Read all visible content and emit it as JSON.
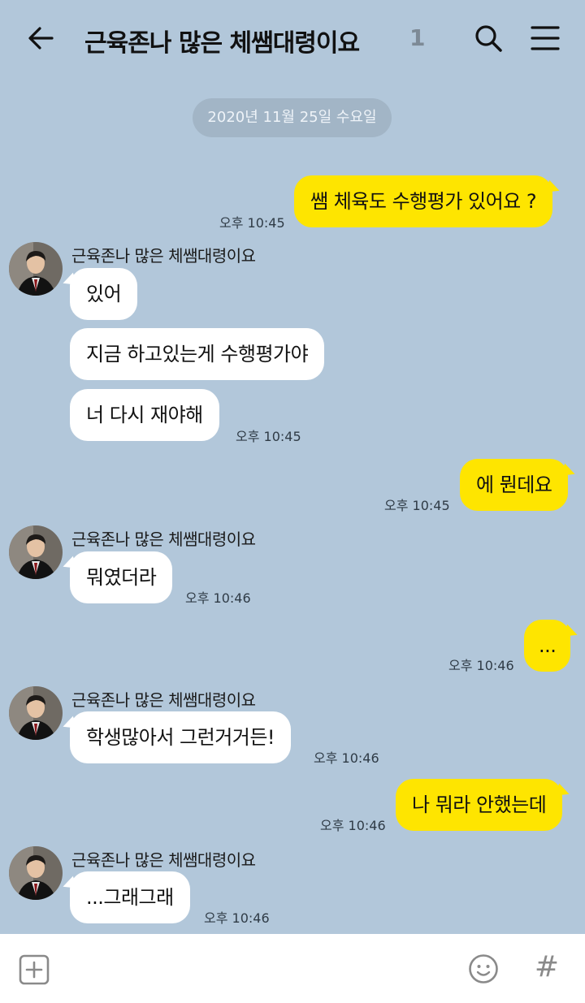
{
  "header": {
    "title": "근육존나 많은 체쌤대령이요",
    "member_count": "1"
  },
  "date_divider": "2020년 11월 25일 수요일",
  "messages": [
    {
      "text": "쌤 체육도 수행평가 있어요 ?",
      "time": "오후 10:45"
    },
    {
      "sender": "근육존나 많은 체쌤대령이요"
    },
    {
      "text": "있어"
    },
    {
      "text": "지금 하고있는게 수행평가야"
    },
    {
      "text": "너 다시 재야해",
      "time": "오후 10:45"
    },
    {
      "text": "에 뭔데요",
      "time": "오후 10:45"
    },
    {
      "sender": "근육존나 많은 체쌤대령이요"
    },
    {
      "text": "뭐였더라",
      "time": "오후 10:46"
    },
    {
      "text": "...",
      "time": "오후 10:46"
    },
    {
      "sender": "근육존나 많은 체쌤대령이요"
    },
    {
      "text": "학생많아서 그런거거든!",
      "time": "오후 10:46"
    },
    {
      "text": "나 뭐라 안했는데",
      "time": "오후 10:46"
    },
    {
      "sender": "근육존나 많은 체쌤대령이요"
    },
    {
      "text": "...그래그래",
      "time": "오후 10:46"
    }
  ],
  "input_bar": {
    "hash_label": "#"
  },
  "icons": {
    "back": "back-arrow-icon",
    "search": "search-icon",
    "menu": "hamburger-menu-icon",
    "attach": "plus-square-icon",
    "emoji": "emoji-icon"
  },
  "colors": {
    "background": "#b2c7da",
    "outgoing_bubble": "#fee500",
    "incoming_bubble": "#ffffff"
  }
}
